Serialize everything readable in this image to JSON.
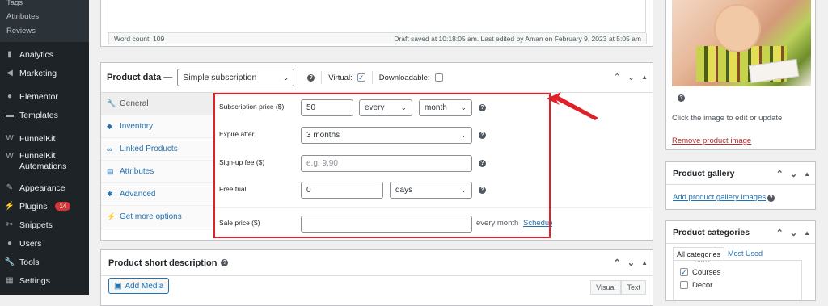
{
  "sidebar": {
    "sub_items": [
      "Tags",
      "Attributes",
      "Reviews"
    ],
    "items": [
      {
        "label": "Analytics",
        "icon": "analytics-icon"
      },
      {
        "label": "Marketing",
        "icon": "megaphone-icon"
      },
      {
        "label": "Elementor",
        "icon": "elementor-icon"
      },
      {
        "label": "Templates",
        "icon": "folder-icon"
      },
      {
        "label": "FunnelKit",
        "icon": "funnelkit-icon"
      },
      {
        "label": "FunnelKit Automations",
        "icon": "funnelkit-icon"
      },
      {
        "label": "Appearance",
        "icon": "paintbrush-icon"
      },
      {
        "label": "Plugins",
        "icon": "plug-icon",
        "badge": "14"
      },
      {
        "label": "Snippets",
        "icon": "scissors-icon"
      },
      {
        "label": "Users",
        "icon": "user-icon"
      },
      {
        "label": "Tools",
        "icon": "wrench-icon"
      },
      {
        "label": "Settings",
        "icon": "settings-icon"
      }
    ]
  },
  "editor": {
    "word_count": "Word count: 109",
    "draft_status": "Draft saved at 10:18:05 am. Last edited by Aman on February 9, 2023 at 5:05 am"
  },
  "product_data": {
    "title": "Product data —",
    "type_select": "Simple subscription",
    "virtual_label": "Virtual:",
    "virtual_checked": true,
    "downloadable_label": "Downloadable:",
    "downloadable_checked": false,
    "tabs": [
      {
        "label": "General",
        "icon": "wrench-icon",
        "active": true
      },
      {
        "label": "Inventory",
        "icon": "tag-icon"
      },
      {
        "label": "Linked Products",
        "icon": "link-icon"
      },
      {
        "label": "Attributes",
        "icon": "list-icon"
      },
      {
        "label": "Advanced",
        "icon": "gear-icon"
      },
      {
        "label": "Get more options",
        "icon": "plug-icon"
      }
    ],
    "fields": {
      "subscription_price_label": "Subscription price ($)",
      "subscription_price_value": "50",
      "period_interval": "every",
      "period_unit": "month",
      "expire_label": "Expire after",
      "expire_value": "3 months",
      "signup_label": "Sign-up fee ($)",
      "signup_placeholder": "e.g. 9.90",
      "trial_label": "Free trial",
      "trial_value": "0",
      "trial_unit": "days",
      "sale_label": "Sale price ($)",
      "sale_value": "",
      "sale_period": "every month",
      "schedule_link": "Schedule"
    }
  },
  "short_description": {
    "title": "Product short description",
    "add_media": "Add Media",
    "tab_visual": "Visual",
    "tab_text": "Text"
  },
  "product_image": {
    "caption": "Click the image to edit or update",
    "remove_link": "Remove product image"
  },
  "product_gallery": {
    "title": "Product gallery",
    "add_link": "Add product gallery images"
  },
  "product_categories": {
    "title": "Product categories",
    "tab_all": "All categories",
    "tab_most_used": "Most Used",
    "items": [
      {
        "label": "Courses",
        "checked": true
      },
      {
        "label": "Decor",
        "checked": false
      }
    ]
  },
  "colors": {
    "highlight": "#e0202a",
    "link": "#2271b1",
    "sidebar_bg": "#1d2327"
  }
}
